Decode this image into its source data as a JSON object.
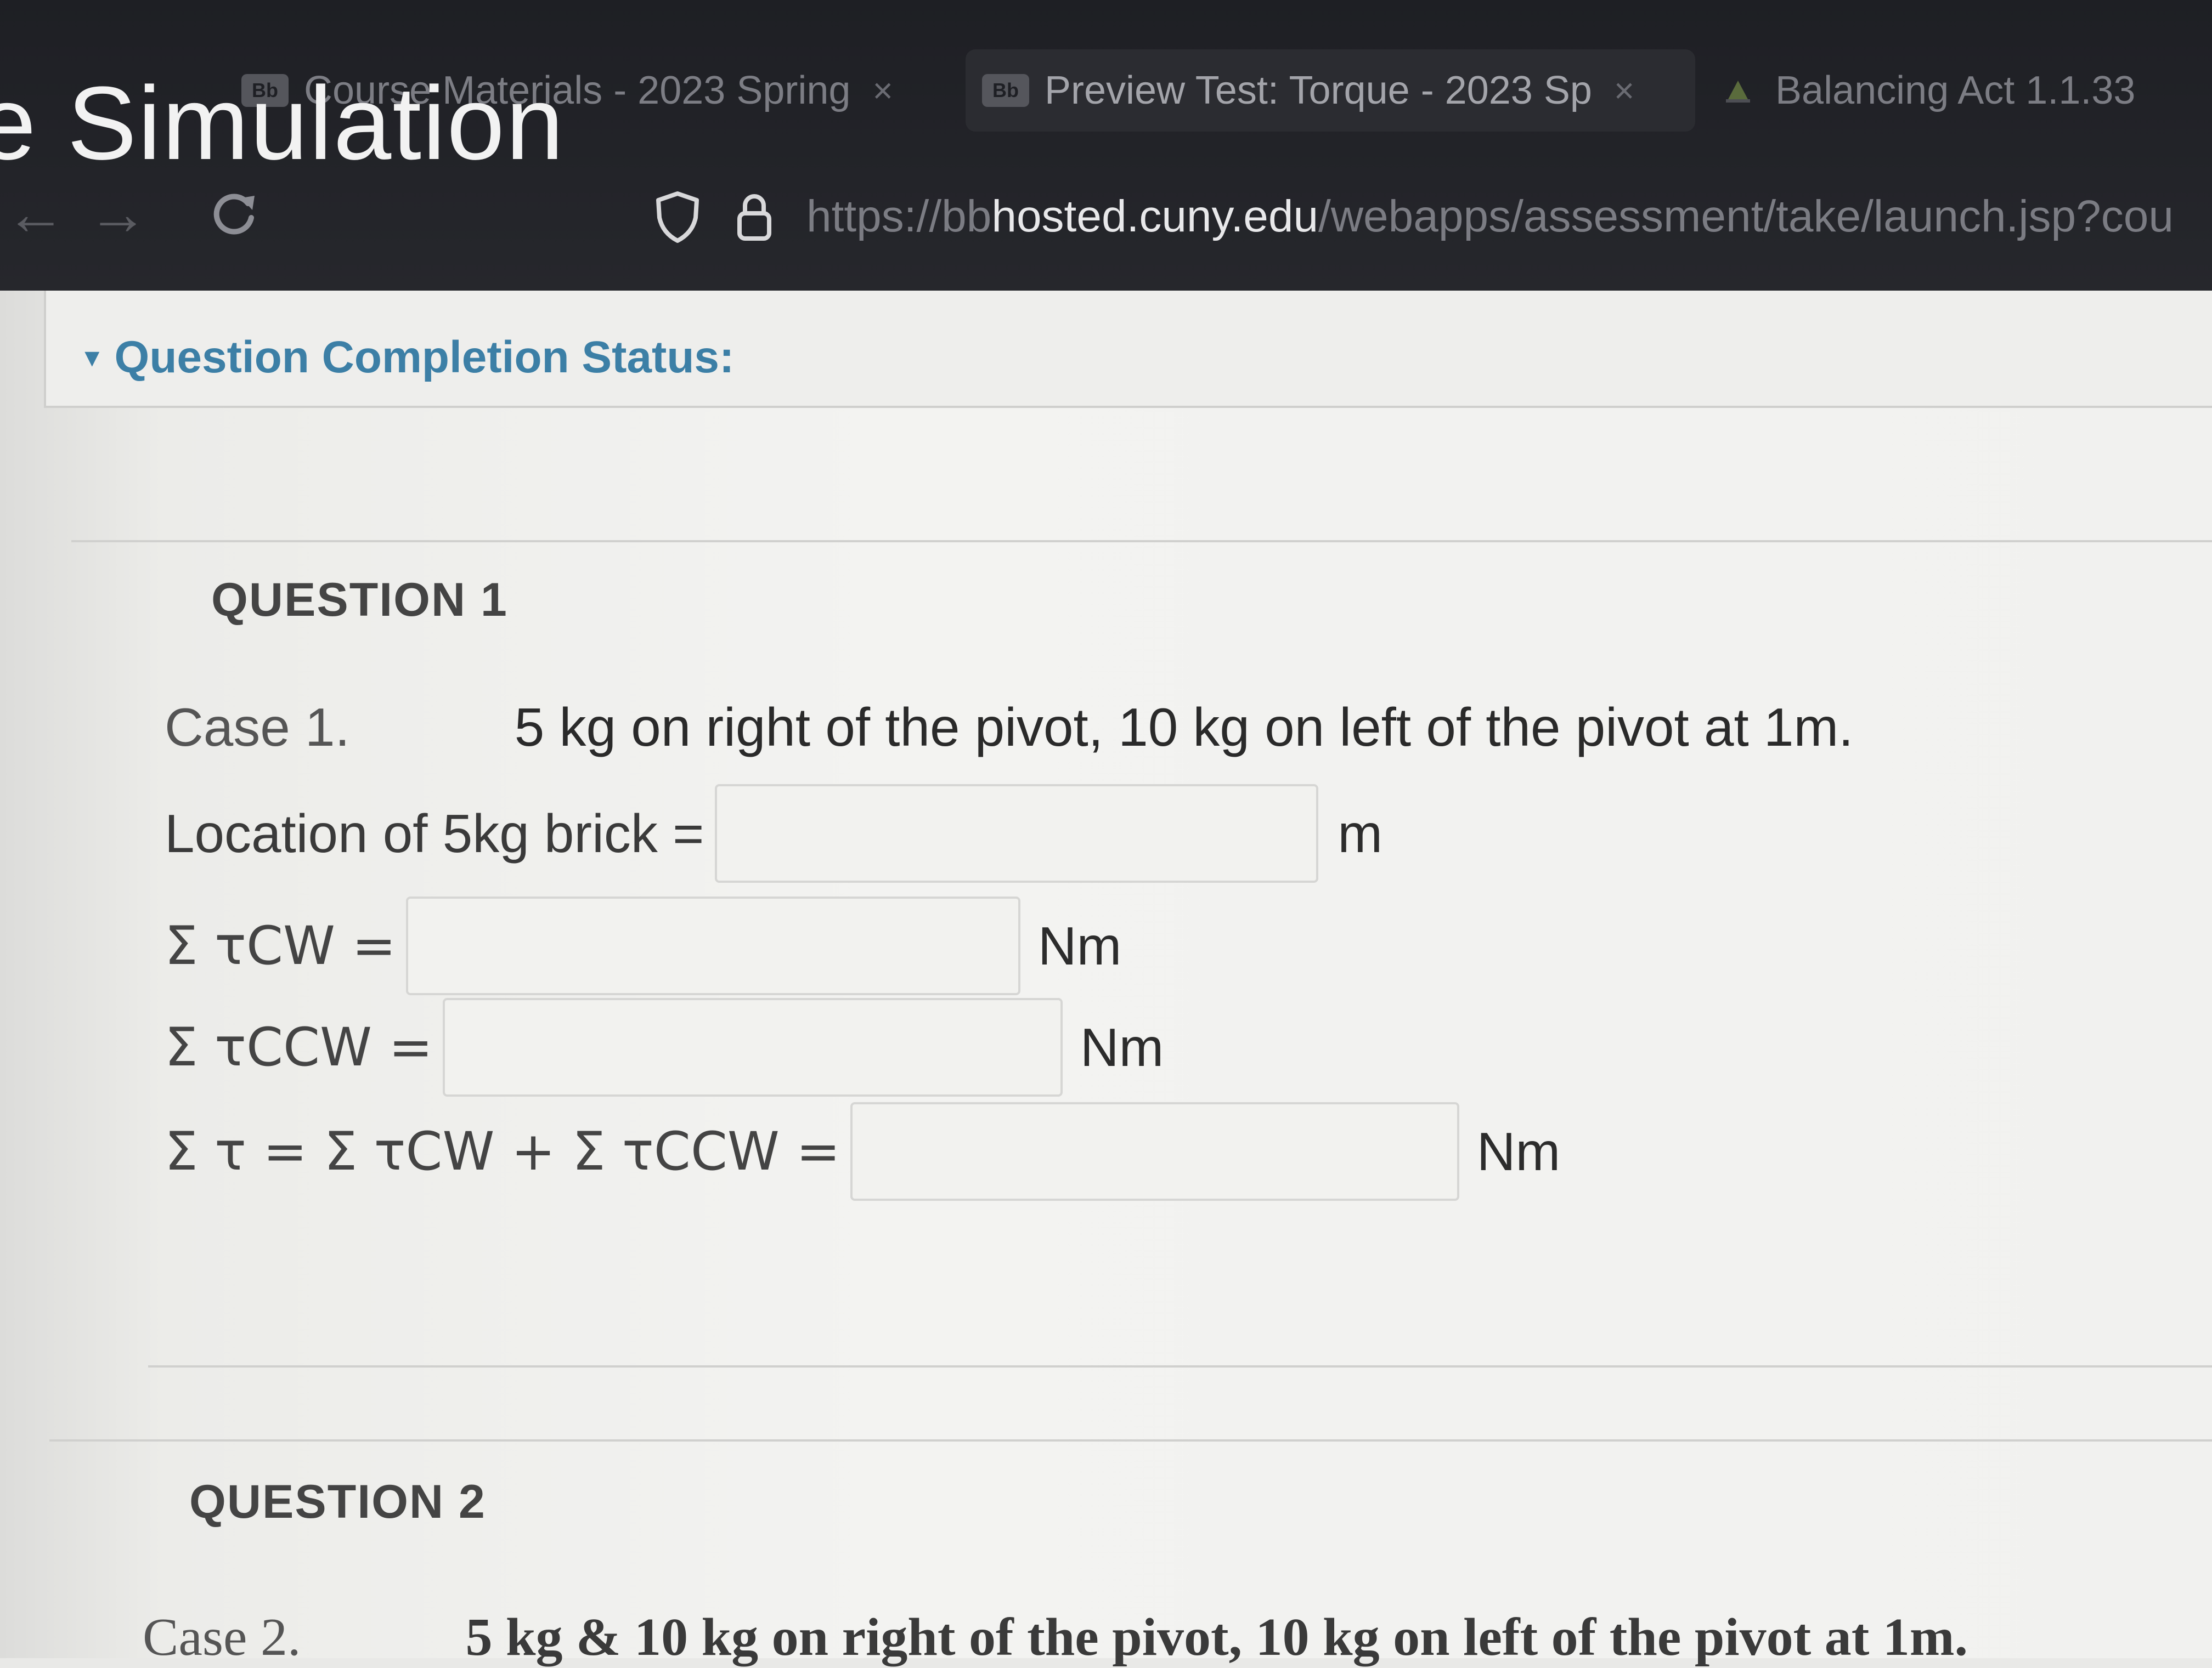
{
  "browser": {
    "tabs": [
      {
        "favicon": "Bb",
        "label": "Course Materials - 2023 Spring",
        "close": "×"
      },
      {
        "favicon": "Bb",
        "label": "Preview Test: Torque - 2023 Sp",
        "close": "×"
      },
      {
        "favicon": "simulation-icon",
        "label": "Balancing Act 1.1.33"
      }
    ],
    "overlay_title": "e Simulation",
    "url": {
      "prefix": "https://bb",
      "domain": "hosted.cuny.edu",
      "path": "/webapps/assessment/take/launch.jsp?cou"
    },
    "icons": {
      "back": "arrow-left-icon",
      "forward": "arrow-right-icon",
      "reload": "reload-icon",
      "tracking": "shield-icon",
      "secure": "lock-icon"
    }
  },
  "status": {
    "label": "Question Completion Status:"
  },
  "question1": {
    "heading": "QUESTION 1",
    "case_label": "Case 1.",
    "case_text": "5 kg on right of the pivot, 10 kg on left of the pivot at 1m.",
    "location_label": "Location of 5kg brick =",
    "location_value": "",
    "location_unit": "m",
    "cw_label": "Σ τCW =",
    "cw_value": "",
    "cw_unit": "Nm",
    "ccw_label": "Σ τCCW =",
    "ccw_value": "",
    "ccw_unit": "Nm",
    "total_label": "Σ τ = Σ τCW + Σ τCCW =",
    "total_value": "",
    "total_unit": "Nm"
  },
  "question2": {
    "heading": "QUESTION 2",
    "case_label": "Case 2.",
    "case_text": "5 kg & 10 kg on right of the pivot, 10 kg on left of the pivot at 1m."
  },
  "colors": {
    "link_blue": "#3c7fa6",
    "chrome_bg": "#1e1f24",
    "page_bg": "#f1f1ef"
  }
}
